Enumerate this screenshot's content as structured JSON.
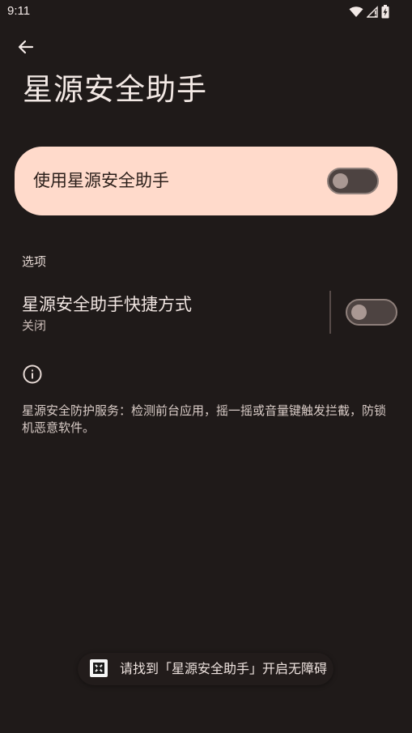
{
  "status_bar": {
    "time": "9:11",
    "icons": [
      "wifi-icon",
      "cell-signal-icon",
      "battery-charging-icon"
    ]
  },
  "header": {
    "back_icon": "arrow-back-icon",
    "title": "星源安全助手"
  },
  "main_switch": {
    "label": "使用星源安全助手",
    "checked": false
  },
  "options": {
    "section_title": "选项",
    "shortcut": {
      "title": "星源安全助手快捷方式",
      "summary": "关闭",
      "checked": false
    }
  },
  "info": {
    "icon": "info-icon",
    "description": "星源安全防护服务：检测前台应用，摇一摇或音量键触发拦截，防锁机恶意软件。"
  },
  "toast": {
    "icon": "app-icon",
    "text": "请找到「星源安全助手」开启无障碍"
  },
  "colors": {
    "background": "#1f1a19",
    "card": "#ffdacb",
    "toggle_track": "#4d4341",
    "toggle_thumb": "#a99893"
  }
}
